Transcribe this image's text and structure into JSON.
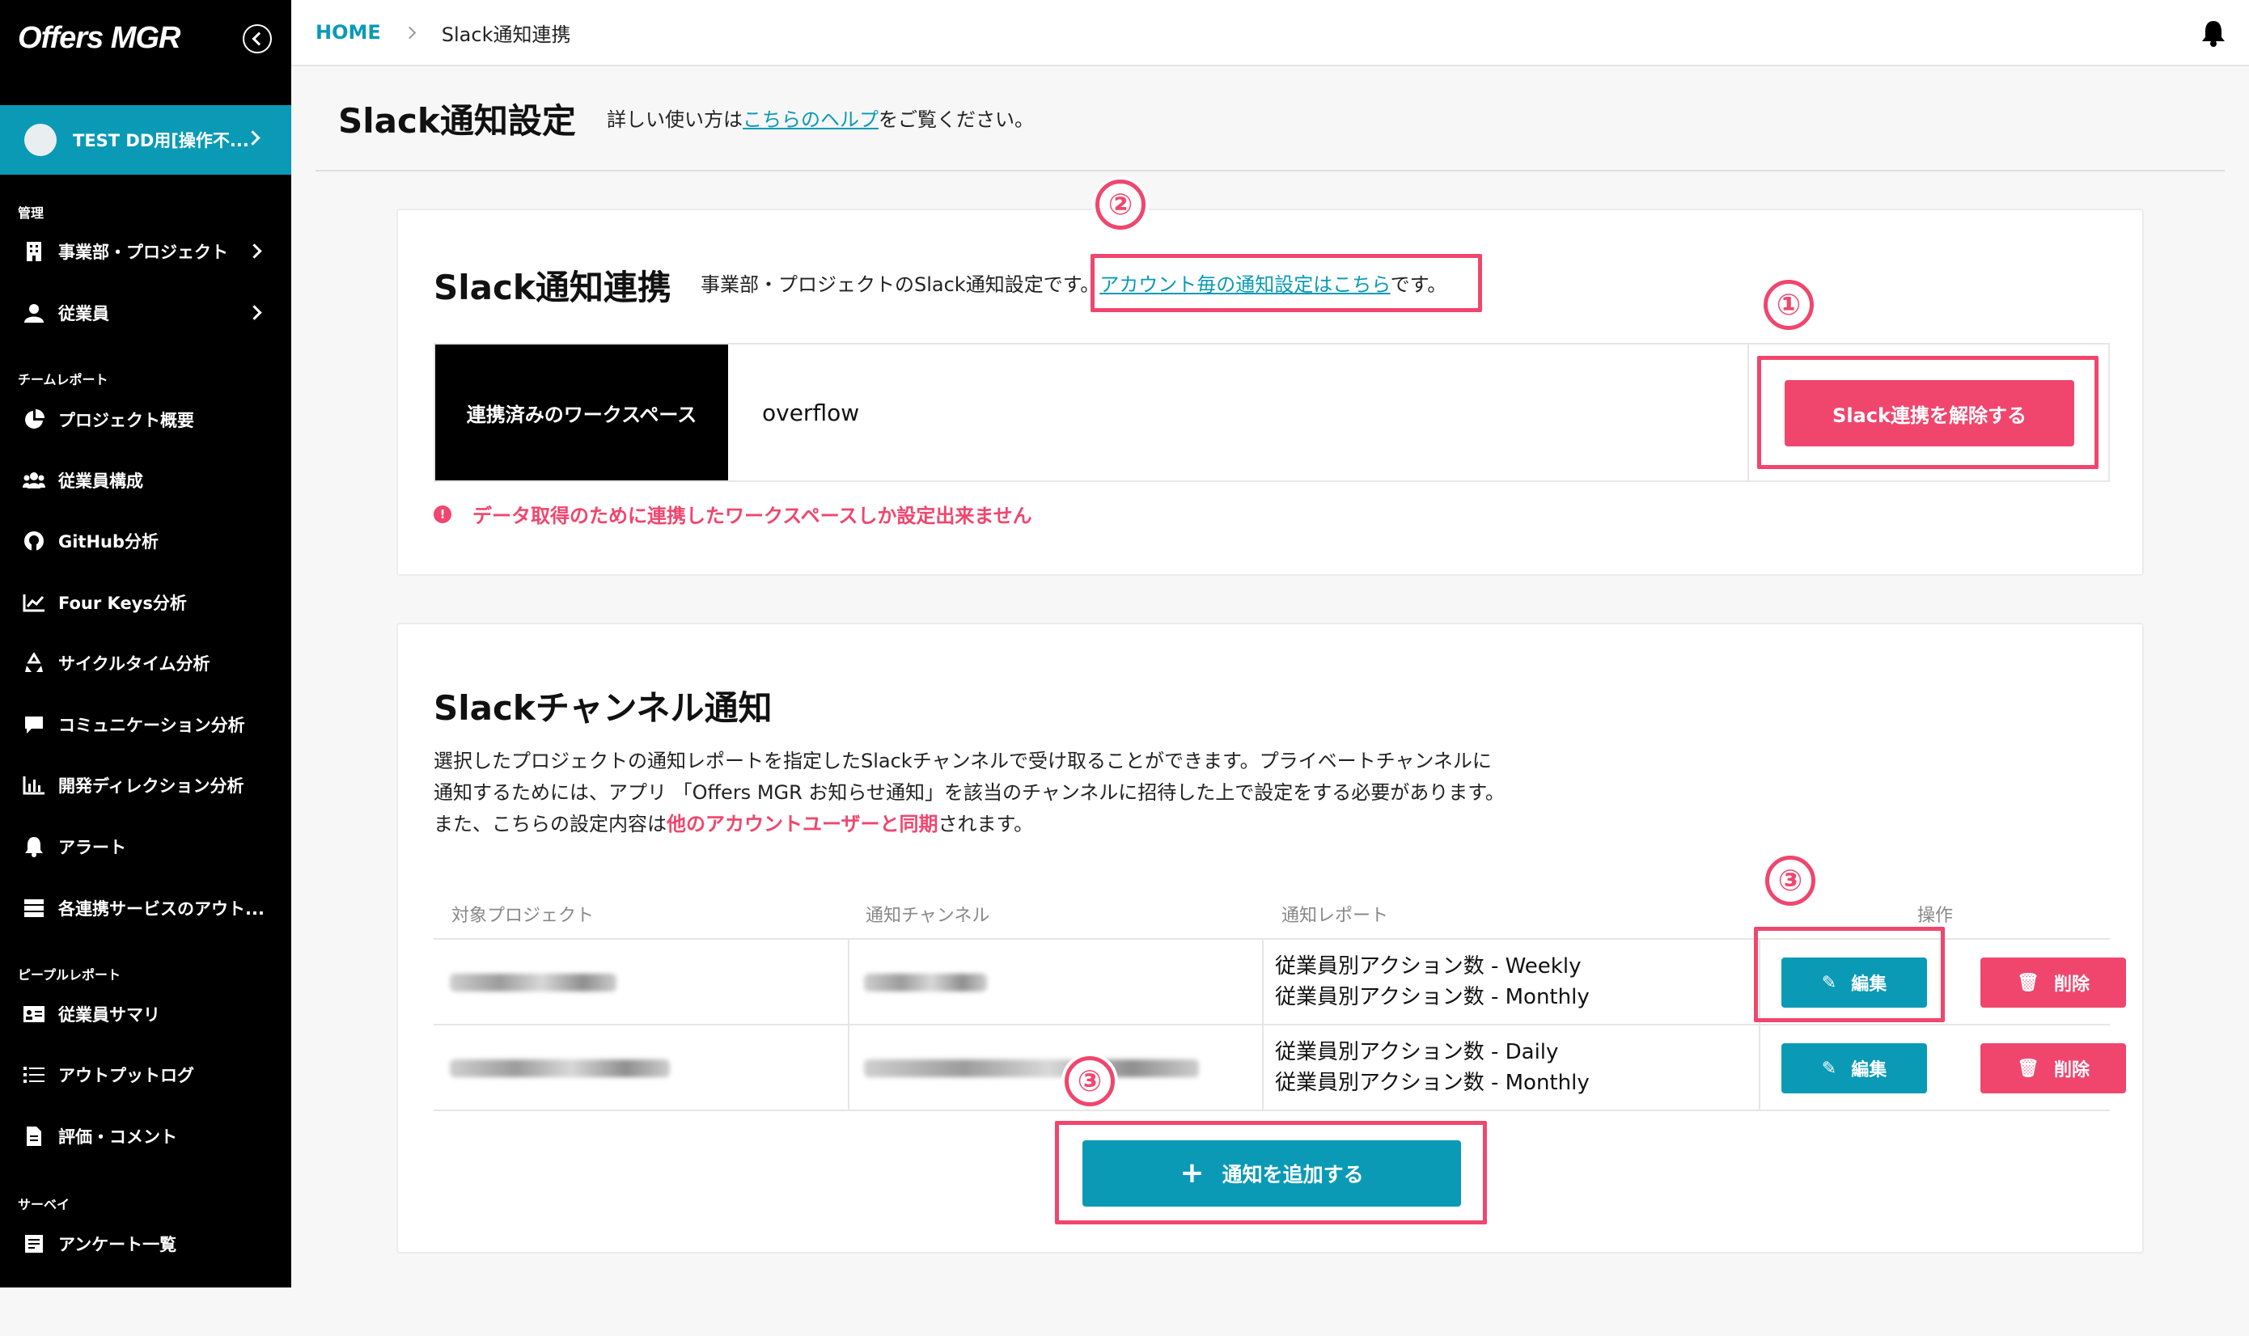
{
  "app": {
    "logo": "Offers MGR"
  },
  "user": {
    "name": "TEST DD用[操作不..."
  },
  "sidebar": {
    "sections": {
      "manage": "管理",
      "team": "チームレポート",
      "people": "ピープルレポート",
      "survey": "サーベイ"
    },
    "items": [
      {
        "label": "事業部・プロジェクト",
        "icon": "building-icon"
      },
      {
        "label": "従業員",
        "icon": "person-icon"
      },
      {
        "label": "プロジェクト概要",
        "icon": "pie-chart-icon"
      },
      {
        "label": "従業員構成",
        "icon": "users-icon"
      },
      {
        "label": "GitHub分析",
        "icon": "github-icon"
      },
      {
        "label": "Four Keys分析",
        "icon": "line-chart-icon"
      },
      {
        "label": "サイクルタイム分析",
        "icon": "recycle-icon"
      },
      {
        "label": "コミュニケーション分析",
        "icon": "chat-icon"
      },
      {
        "label": "開発ディレクション分析",
        "icon": "bar-chart-icon"
      },
      {
        "label": "アラート",
        "icon": "bell-icon"
      },
      {
        "label": "各連携サービスのアウト...",
        "icon": "server-icon"
      },
      {
        "label": "従業員サマリ",
        "icon": "id-card-icon"
      },
      {
        "label": "アウトプットログ",
        "icon": "list-icon"
      },
      {
        "label": "評価・コメント",
        "icon": "document-icon"
      },
      {
        "label": "アンケート一覧",
        "icon": "form-icon"
      }
    ]
  },
  "breadcrumb": {
    "home": "HOME",
    "current": "Slack通知連携"
  },
  "page": {
    "title": "Slack通知設定",
    "help_prefix": "詳しい使い方は",
    "help_link": "こちらのヘルプ",
    "help_suffix": "をご覧ください。"
  },
  "integration": {
    "title": "Slack通知連携",
    "desc_prefix": "事業部・プロジェクトのSlack通知設定です。",
    "desc_link": "アカウント毎の通知設定はこちら",
    "desc_suffix": "です。",
    "workspace_label": "連携済みのワークスペース",
    "workspace_value": "overflow",
    "unlink_label": "Slack連携を解除する",
    "warning": "データ取得のために連携したワークスペースしか設定出来ません"
  },
  "channels": {
    "title": "Slackチャンネル通知",
    "desc_line1": "選択したプロジェクトの通知レポートを指定したSlackチャンネルで受け取ることができます。プライベートチャンネルに",
    "desc_line2": "通知するためには、アプリ 「Offers MGR お知らせ通知」を該当のチャンネルに招待した上で設定をする必要があります。",
    "desc_line3_prefix": "また、こちらの設定内容は",
    "desc_line3_highlight": "他のアカウントユーザーと同期",
    "desc_line3_suffix": "されます。",
    "columns": [
      "対象プロジェクト",
      "通知チャンネル",
      "通知レポート",
      "操作"
    ],
    "rows": [
      {
        "reports": [
          "従業員別アクション数 - Weekly",
          "従業員別アクション数 - Monthly"
        ]
      },
      {
        "reports": [
          "従業員別アクション数 - Daily",
          "従業員別アクション数 - Monthly"
        ]
      }
    ],
    "edit_label": "編集",
    "delete_label": "削除",
    "add_label": "通知を追加する"
  },
  "annotations": {
    "one": "①",
    "two": "②",
    "three": "③"
  },
  "colors": {
    "accent": "#0a9ab5",
    "danger": "#f0466e",
    "sidebar": "#000000"
  }
}
